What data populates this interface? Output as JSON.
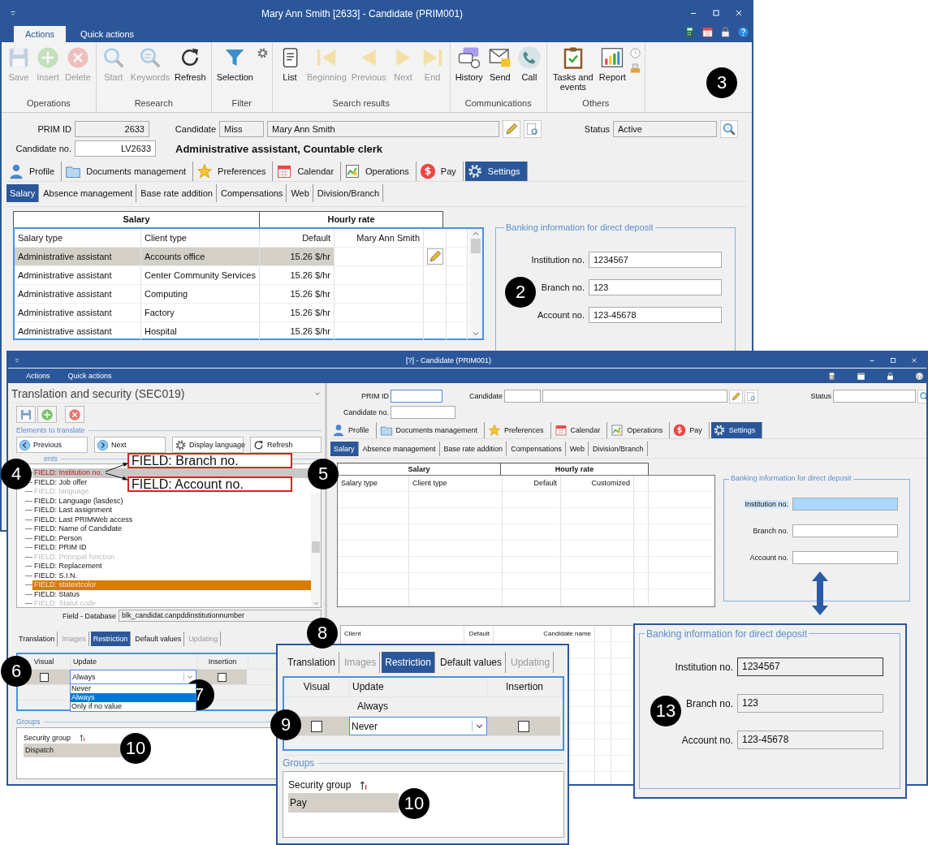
{
  "main_window": {
    "title": "Mary Ann Smith [2633] - Candidate (PRIM001)",
    "ribbon_tabs": [
      {
        "label": "Actions",
        "selected": true
      },
      {
        "label": "Quick actions",
        "selected": false
      }
    ],
    "ribbon_groups": [
      {
        "label": "Operations",
        "buttons": [
          {
            "label": "Save",
            "disabled": true
          },
          {
            "label": "Insert",
            "disabled": true
          },
          {
            "label": "Delete",
            "disabled": true
          }
        ]
      },
      {
        "label": "Research",
        "buttons": [
          {
            "label": "Start",
            "disabled": true
          },
          {
            "label": "Keywords",
            "disabled": true
          },
          {
            "label": "Refresh",
            "disabled": false
          }
        ]
      },
      {
        "label": "Filter",
        "buttons": [
          {
            "label": "Selection",
            "disabled": false
          }
        ]
      },
      {
        "label": "Search results",
        "buttons": [
          {
            "label": "List",
            "disabled": false
          },
          {
            "label": "Beginning",
            "disabled": true
          },
          {
            "label": "Previous",
            "disabled": true
          },
          {
            "label": "Next",
            "disabled": true
          },
          {
            "label": "End",
            "disabled": true
          }
        ]
      },
      {
        "label": "Communications",
        "buttons": [
          {
            "label": "History",
            "disabled": false
          },
          {
            "label": "Send",
            "disabled": false
          },
          {
            "label": "Call",
            "disabled": false
          }
        ]
      },
      {
        "label": "Others",
        "buttons": [
          {
            "label": "Tasks and events",
            "disabled": false
          },
          {
            "label": "Report",
            "disabled": false
          }
        ]
      }
    ],
    "form": {
      "prim_id_label": "PRIM ID",
      "prim_id": "2633",
      "candidate_label": "Candidate",
      "candidate_title": "Miss",
      "candidate_name": "Mary Ann Smith",
      "status_label": "Status",
      "status": "Active",
      "candidate_no_label": "Candidate no.",
      "candidate_no": "LV2633",
      "position": "Administrative assistant, Countable clerk"
    },
    "tabs": [
      {
        "label": "Profile",
        "selected": false
      },
      {
        "label": "Documents management",
        "selected": false
      },
      {
        "label": "Preferences",
        "selected": false
      },
      {
        "label": "Calendar",
        "selected": false
      },
      {
        "label": "Operations",
        "selected": false
      },
      {
        "label": "Pay",
        "selected": false
      },
      {
        "label": "Settings",
        "selected": true
      }
    ],
    "subtabs": [
      {
        "label": "Salary",
        "selected": true
      },
      {
        "label": "Absence management",
        "selected": false
      },
      {
        "label": "Base rate addition",
        "selected": false
      },
      {
        "label": "Compensations",
        "selected": false
      },
      {
        "label": "Web",
        "selected": false
      },
      {
        "label": "Division/Branch",
        "selected": false
      }
    ],
    "salary_table": {
      "group_headers": [
        "Salary",
        "Hourly rate"
      ],
      "columns": [
        "Salary type",
        "Client type",
        "Default",
        "Mary Ann Smith"
      ],
      "rows": [
        {
          "cells": [
            "Administrative assistant",
            "Accounts office",
            "15.26 $/hr"
          ],
          "selected": true
        },
        {
          "cells": [
            "Administrative assistant",
            "Center Community Services",
            "15.26 $/hr"
          ],
          "selected": false
        },
        {
          "cells": [
            "Administrative assistant",
            "Computing",
            "15.26 $/hr"
          ],
          "selected": false
        },
        {
          "cells": [
            "Administrative assistant",
            "Factory",
            "15.26 $/hr"
          ],
          "selected": false
        },
        {
          "cells": [
            "Administrative assistant",
            "Hospital",
            "15.26 $/hr"
          ],
          "selected": false
        }
      ]
    },
    "banking": {
      "title": "Banking information for direct deposit",
      "fields": [
        {
          "label": "Institution no.",
          "value": "1234567",
          "highlighted": false
        },
        {
          "label": "Branch no.",
          "value": "123",
          "highlighted": false
        },
        {
          "label": "Account no.",
          "value": "123-45678",
          "highlighted": false
        }
      ]
    }
  },
  "translation_window": {
    "title": "[?] - Candidate (PRIM001)",
    "menu": [
      "Actions",
      "Quick actions"
    ],
    "security_panel": {
      "title": "Translation and security (SEC019)",
      "section": "Elements to translate",
      "nav_buttons": [
        "Previous",
        "Next",
        "Display language",
        "Refresh"
      ],
      "elements_label": "ents",
      "elements": [
        {
          "label": "FIELD: Institution no.",
          "selected": true,
          "highlighted": false,
          "disabled": false
        },
        {
          "label": "FIELD: Job offer",
          "selected": false,
          "highlighted": false,
          "disabled": false
        },
        {
          "label": "FIELD: language",
          "selected": false,
          "highlighted": false,
          "disabled": true
        },
        {
          "label": "FIELD: Language  (lasdesc)",
          "selected": false,
          "highlighted": false,
          "disabled": false
        },
        {
          "label": "FIELD: Last assignment",
          "selected": false,
          "highlighted": false,
          "disabled": false
        },
        {
          "label": "FIELD: Last PRIMWeb access",
          "selected": false,
          "highlighted": false,
          "disabled": false
        },
        {
          "label": "FIELD: Name of Candidate",
          "selected": false,
          "highlighted": false,
          "disabled": false
        },
        {
          "label": "FIELD: Person",
          "selected": false,
          "highlighted": false,
          "disabled": false
        },
        {
          "label": "FIELD: PRIM ID",
          "selected": false,
          "highlighted": false,
          "disabled": false
        },
        {
          "label": "FIELD: Principal function",
          "selected": false,
          "highlighted": false,
          "disabled": true
        },
        {
          "label": "FIELD: Replacement",
          "selected": false,
          "highlighted": false,
          "disabled": false
        },
        {
          "label": "FIELD: S.I.N.",
          "selected": false,
          "highlighted": false,
          "disabled": false
        },
        {
          "label": "FIELD: statextcolor",
          "selected": false,
          "highlighted": true,
          "disabled": false
        },
        {
          "label": "FIELD: Status",
          "selected": false,
          "highlighted": false,
          "disabled": false
        },
        {
          "label": "FIELD: Statut code",
          "selected": false,
          "highlighted": false,
          "disabled": true
        }
      ],
      "field_database_label": "Field - Database",
      "field_database": "blk_candidat.canpddinstitutionnumber",
      "tabs": [
        {
          "label": "Translation",
          "selected": false,
          "disabled": false
        },
        {
          "label": "Images",
          "selected": false,
          "disabled": true
        },
        {
          "label": "Restriction",
          "selected": true,
          "disabled": false
        },
        {
          "label": "Default values",
          "selected": false,
          "disabled": false
        },
        {
          "label": "Updating",
          "selected": false,
          "disabled": true
        }
      ],
      "restriction": {
        "columns": [
          "Visual",
          "Update",
          "Insertion"
        ],
        "rows": [
          {
            "kind": "edit",
            "selected": true,
            "visual_checked": false,
            "update": "Always",
            "insertion_checked": false,
            "open": true
          }
        ],
        "dropdown_options": [
          {
            "label": "Never",
            "selected": false
          },
          {
            "label": "Always",
            "selected": true
          },
          {
            "label": "Only if no value",
            "selected": false
          }
        ]
      },
      "groups_label": "Groups",
      "groups": {
        "column": "Security group",
        "rows": [
          {
            "label": "Dispatch",
            "selected": true
          }
        ]
      }
    },
    "candidate_form": {
      "prim_id_label": "PRIM ID",
      "candidate_label": "Candidate",
      "status_label": "Status",
      "candidate_no_label": "Candidate no.",
      "tabs": [
        {
          "label": "Profile",
          "selected": false
        },
        {
          "label": "Documents management",
          "selected": false
        },
        {
          "label": "Preferences",
          "selected": false
        },
        {
          "label": "Calendar",
          "selected": false
        },
        {
          "label": "Operations",
          "selected": false
        },
        {
          "label": "Pay",
          "selected": false
        },
        {
          "label": "Settings",
          "selected": true
        }
      ],
      "subtabs": [
        {
          "label": "Salary",
          "selected": true
        },
        {
          "label": "Absence management",
          "selected": false
        },
        {
          "label": "Base rate addition",
          "selected": false
        },
        {
          "label": "Compensations",
          "selected": false
        },
        {
          "label": "Web",
          "selected": false
        },
        {
          "label": "Division/Branch",
          "selected": false
        }
      ],
      "salary_table": {
        "group_headers": [
          "Salary",
          "Hourly rate"
        ],
        "columns": [
          "Salary type",
          "Client type",
          "Default",
          "Customized"
        ]
      },
      "banking": {
        "title": "Banking information for direct deposit",
        "fields": [
          {
            "label": "Institution no.",
            "highlighted": true
          },
          {
            "label": "Branch no.",
            "highlighted": false
          },
          {
            "label": "Account no.",
            "highlighted": false
          }
        ]
      },
      "lower_table": {
        "columns": [
          "Client",
          "Default",
          "Candidate name"
        ]
      }
    }
  },
  "restriction_zoom": {
    "tabs": [
      {
        "label": "Translation",
        "selected": false,
        "disabled": false
      },
      {
        "label": "Images",
        "selected": false,
        "disabled": true
      },
      {
        "label": "Restriction",
        "selected": true,
        "disabled": false
      },
      {
        "label": "Default values",
        "selected": false,
        "disabled": false
      },
      {
        "label": "Updating",
        "selected": false,
        "disabled": true
      }
    ],
    "columns": [
      "Visual",
      "Update",
      "Insertion"
    ],
    "rows": [
      {
        "kind": "text",
        "selected": false,
        "update": "Always"
      },
      {
        "kind": "edit",
        "selected": true,
        "visual_checked": false,
        "update": "Never",
        "insertion_checked": false,
        "open": false
      }
    ],
    "groups_label": "Groups",
    "groups": {
      "column": "Security group",
      "rows": [
        {
          "label": "Pay",
          "selected": true
        }
      ]
    }
  },
  "banking_zoom": {
    "title": "Banking information for direct deposit",
    "fields": [
      {
        "label": "Institution no.",
        "value": "1234567",
        "focused": true
      },
      {
        "label": "Branch no.",
        "value": "123",
        "focused": false
      },
      {
        "label": "Account no.",
        "value": "123-45678",
        "focused": false
      }
    ]
  },
  "annotations": [
    {
      "text": "FIELD: Branch no."
    },
    {
      "text": "FIELD: Account no."
    }
  ],
  "callouts": [
    "3",
    "2",
    "4",
    "5",
    "6",
    "7",
    "8",
    "9",
    "10",
    "10",
    "13"
  ]
}
